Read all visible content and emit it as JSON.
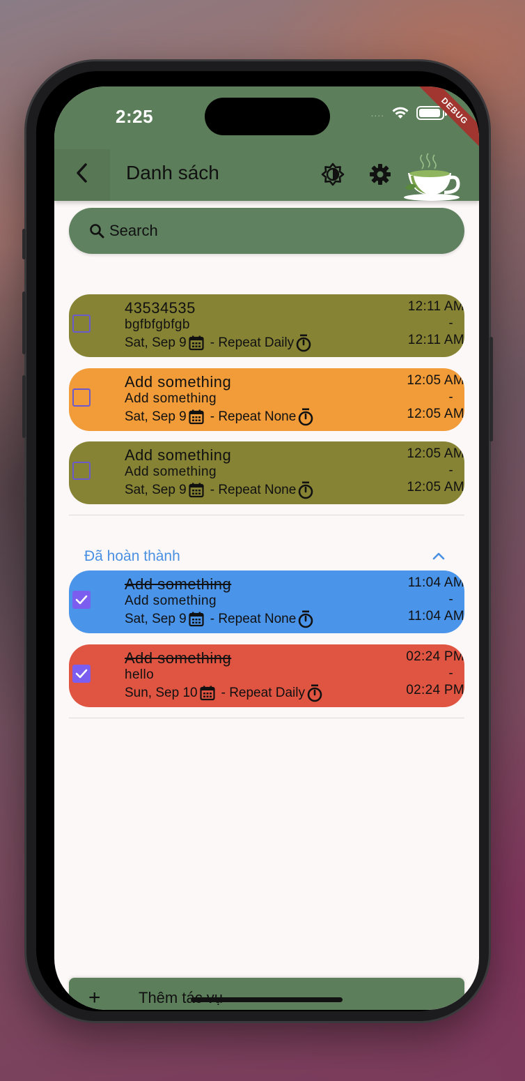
{
  "status_bar": {
    "time": "2:25",
    "signal": "....",
    "debug_label": "DEBUG"
  },
  "app_bar": {
    "title": "Danh sách"
  },
  "search": {
    "label": "Search"
  },
  "tasks": [
    {
      "title": "43534535",
      "description": "bgfbfgbfgb",
      "date": "Sat, Sep 9",
      "repeat": "- Repeat Daily",
      "start": "12:11 AM",
      "dash": "-",
      "end": "12:11 AM",
      "color": "#868334",
      "done": false
    },
    {
      "title": "Add something",
      "description": "Add something",
      "date": "Sat, Sep 9",
      "repeat": "- Repeat None",
      "start": "12:05 AM",
      "dash": "-",
      "end": "12:05 AM",
      "color": "#f19c39",
      "done": false
    },
    {
      "title": "Add something",
      "description": "Add something",
      "date": "Sat, Sep 9",
      "repeat": "- Repeat None",
      "start": "12:05 AM",
      "dash": "-",
      "end": "12:05 AM",
      "color": "#868334",
      "done": false
    }
  ],
  "completed_section": {
    "title": "Đã hoàn thành"
  },
  "completed_tasks": [
    {
      "title": "Add something",
      "description": "Add something",
      "date": "Sat, Sep 9",
      "repeat": "- Repeat None",
      "start": "11:04 AM",
      "dash": "-",
      "end": "11:04 AM",
      "color": "#4a94ea",
      "done": true
    },
    {
      "title": "Add something",
      "description": "hello",
      "date": "Sun, Sep 10",
      "repeat": "- Repeat Daily",
      "start": "02:24 PM",
      "dash": "-",
      "end": "02:24 PM",
      "color": "#e05442",
      "done": true
    }
  ],
  "add_task": {
    "plus": "+",
    "label": "Thêm tác vụ"
  },
  "icons": {
    "back": "chevron-left-icon",
    "theme": "brightness-icon",
    "settings": "gear-icon",
    "search": "search-icon",
    "calendar": "calendar-icon",
    "timer": "timer-icon",
    "collapse": "chevron-up-icon"
  }
}
